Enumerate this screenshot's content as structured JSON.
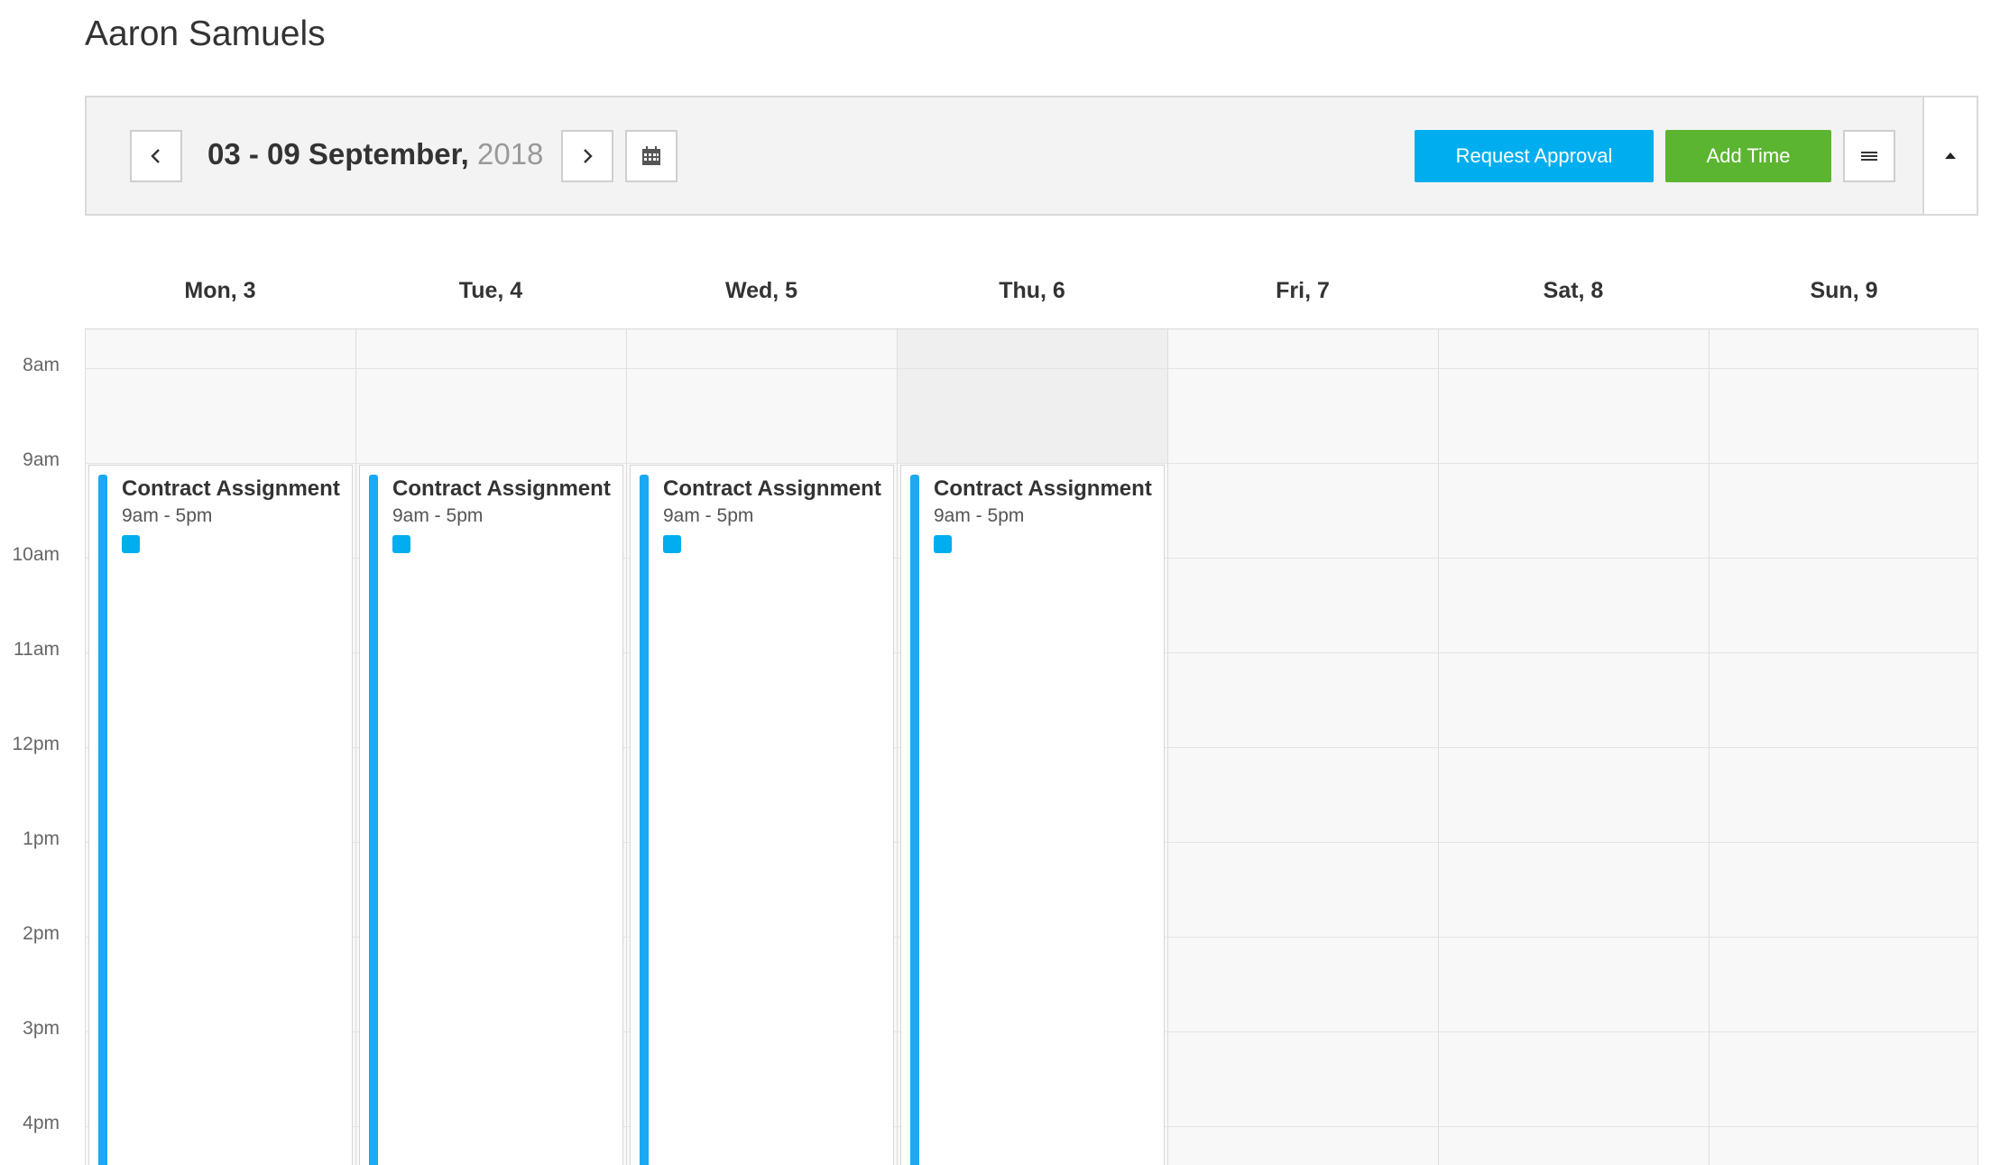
{
  "page": {
    "title": "Aaron Samuels"
  },
  "toolbar": {
    "date_range": "03 - 09 September,",
    "year": "2018",
    "prev_icon": "chevron-left-icon",
    "next_icon": "chevron-right-icon",
    "calendar_icon": "calendar-icon",
    "request_approval_label": "Request Approval",
    "add_time_label": "Add Time",
    "menu_icon": "hamburger-menu-icon",
    "collapse_icon": "caret-up-icon",
    "colors": {
      "request_approval": "#00aeef",
      "add_time": "#5cb531"
    }
  },
  "days": [
    {
      "label": "Mon, 3"
    },
    {
      "label": "Tue, 4"
    },
    {
      "label": "Wed, 5"
    },
    {
      "label": "Thu, 6",
      "today": true
    },
    {
      "label": "Fri, 7"
    },
    {
      "label": "Sat, 8"
    },
    {
      "label": "Sun, 9"
    }
  ],
  "hours": [
    "8am",
    "9am",
    "10am",
    "11am",
    "12pm",
    "1pm",
    "2pm",
    "3pm",
    "4pm"
  ],
  "events": [
    {
      "day": 0,
      "title": "Contract Assignment",
      "time": "9am - 5pm",
      "color": "#1aa9f2"
    },
    {
      "day": 1,
      "title": "Contract Assignment",
      "time": "9am - 5pm",
      "color": "#1aa9f2"
    },
    {
      "day": 2,
      "title": "Contract Assignment",
      "time": "9am - 5pm",
      "color": "#1aa9f2"
    },
    {
      "day": 3,
      "title": "Contract Assignment",
      "time": "9am - 5pm",
      "color": "#1aa9f2"
    }
  ]
}
